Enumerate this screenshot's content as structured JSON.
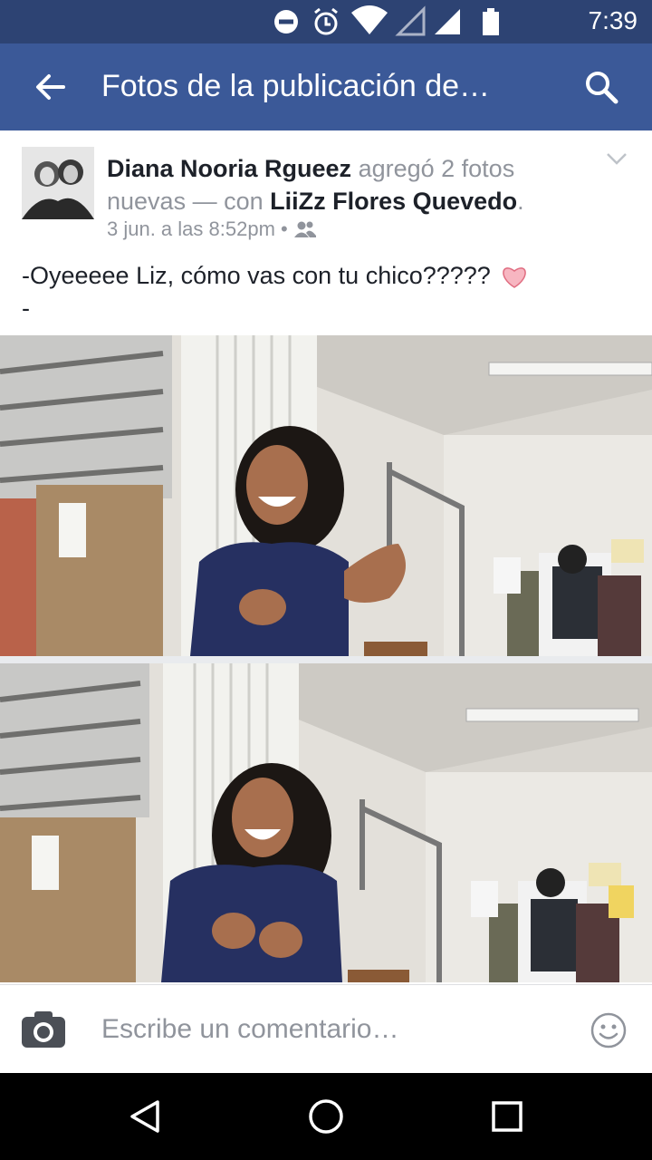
{
  "status_bar": {
    "time": "7:39",
    "icons": [
      "dnd-icon",
      "alarm-icon",
      "wifi-icon",
      "signal-empty-icon",
      "signal-icon",
      "battery-icon"
    ]
  },
  "app_bar": {
    "title": "Fotos de la publicación de…",
    "back_icon": "arrow-left-icon",
    "search_icon": "search-icon",
    "color": "#3b5998"
  },
  "post": {
    "author": "Diana Nooria Rgueez",
    "action": " agregó 2 fotos nuevas — con ",
    "tagged": "LiiZz Flores Quevedo",
    "end": ".",
    "time": "3 jun. a las 8:52pm",
    "dot": " • ",
    "audience_icon": "friends-icon",
    "message": "-Oyeeeee Liz, cómo vas con tu chico?????",
    "message_line2": "-"
  },
  "composer": {
    "placeholder": "Escribe un comentario…",
    "camera_icon": "camera-icon",
    "emoji_icon": "smiley-icon"
  },
  "nav": {
    "icons": [
      "back-triangle-icon",
      "home-circle-icon",
      "recents-square-icon"
    ]
  }
}
